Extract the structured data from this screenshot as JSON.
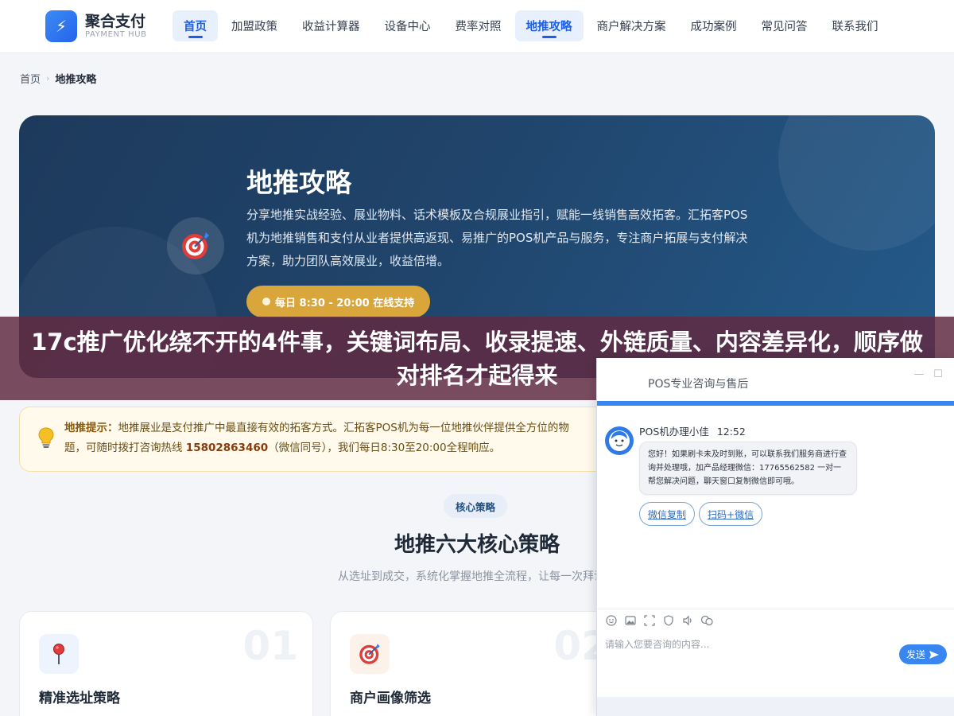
{
  "header": {
    "logo_title": "聚合支付",
    "logo_sub": "PAYMENT HUB",
    "nav": [
      {
        "label": "首页",
        "active": true
      },
      {
        "label": "加盟政策",
        "active": false
      },
      {
        "label": "收益计算器",
        "active": false
      },
      {
        "label": "设备中心",
        "active": false
      },
      {
        "label": "费率对照",
        "active": false
      },
      {
        "label": "地推攻略",
        "active": true
      },
      {
        "label": "商户解决方案",
        "active": false
      },
      {
        "label": "成功案例",
        "active": false
      },
      {
        "label": "常见问答",
        "active": false
      },
      {
        "label": "联系我们",
        "active": false
      }
    ]
  },
  "breadcrumb": {
    "home": "首页",
    "separator": "›",
    "current": "地推攻略"
  },
  "hero": {
    "title": "地推攻略",
    "description": "分享地推实战经验、展业物料、话术模板及合规展业指引，赋能一线销售高效拓客。汇拓客POS机为地推销售和支付从业者提供高返现、易推广的POS机产品与服务，专注商户拓展与支付解决方案，助力团队高效展业，收益倍增。",
    "badge": "每日 8:30 - 20:00 在线支持",
    "icon": "target-icon"
  },
  "tip": {
    "label": "地推提示：",
    "text_before": "地推展业是支付推广中最直接有效的拓客方式。汇拓客POS机为每一位地推伙伴提供全方位的物",
    "text_middle": "题，可随时拨打咨询热线 ",
    "phone": "15802863460",
    "text_after": "（微信同号），我们每日8:30至20:00全程响应。",
    "icon": "lightbulb-icon"
  },
  "section": {
    "pill": "核心策略",
    "title": "地推六大核心策略",
    "subtitle": "从选址到成交，系统化掌握地推全流程，让每一次拜访者"
  },
  "cards": [
    {
      "num": "01",
      "title": "精准选址策略",
      "icon": "pin-icon",
      "icon_bg": "#eef4fd"
    },
    {
      "num": "02",
      "title": "商户画像筛选",
      "icon": "target-icon",
      "icon_bg": "#fdf2ea"
    }
  ],
  "banner": {
    "text": "17c推广优化绕不开的4件事，关键词布局、收录提速、外链质量、内容差异化，顺序做对排名才起得来"
  },
  "chat": {
    "title": "POS专业咨询与售后",
    "minimize": "—",
    "maximize": "☐",
    "agent_name": "POS机办理小佳",
    "time": "12:52",
    "message": "您好！如果刷卡未及时到账，可以联系我们服务商进行查询并处理哦，加产品经理微信：17765562582 一对一帮您解决问题，聊天窗口复制微信即可哦。",
    "actions": [
      "微信复制",
      "扫码+微信"
    ],
    "input_placeholder": "请输入您要咨询的内容...",
    "send_label": "发送",
    "tools": [
      "emoji-icon",
      "image-icon",
      "screenshot-icon",
      "rating-icon",
      "voice-icon",
      "chat-history-icon"
    ]
  }
}
